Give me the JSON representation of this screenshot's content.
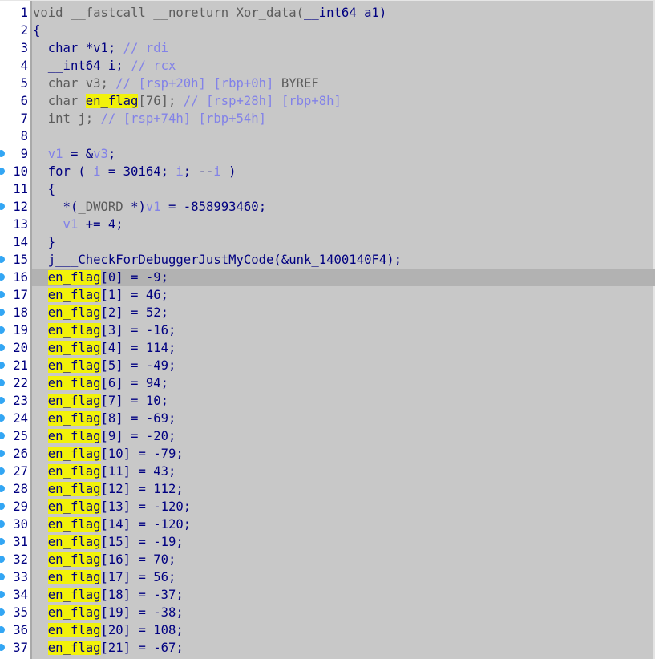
{
  "editor": {
    "function_name": "Xor_data",
    "lines": [
      {
        "no": "1",
        "bp": false,
        "tokens": [
          [
            "gr",
            "void __fastcall __noreturn Xor_data("
          ],
          [
            "k",
            "__int64 a1)"
          ]
        ]
      },
      {
        "no": "2",
        "bp": false,
        "tokens": [
          [
            "k",
            "{"
          ]
        ]
      },
      {
        "no": "3",
        "bp": false,
        "tokens": [
          [
            "k",
            "  char *v1; "
          ],
          [
            "cm",
            "// rdi"
          ]
        ]
      },
      {
        "no": "4",
        "bp": false,
        "tokens": [
          [
            "k",
            "  __int64 i; "
          ],
          [
            "cm",
            "// rcx"
          ]
        ]
      },
      {
        "no": "5",
        "bp": false,
        "tokens": [
          [
            "gr",
            "  char v3; "
          ],
          [
            "cm",
            "// [rsp+20h] [rbp+0h] "
          ],
          [
            "gr",
            "BYREF"
          ]
        ]
      },
      {
        "no": "6",
        "bp": false,
        "tokens": [
          [
            "gr",
            "  char "
          ],
          [
            "hl",
            "en_flag"
          ],
          [
            "gr",
            "[76]; "
          ],
          [
            "cm",
            "// [rsp+28h] [rbp+8h]"
          ]
        ]
      },
      {
        "no": "7",
        "bp": false,
        "tokens": [
          [
            "gr",
            "  int j; "
          ],
          [
            "cm",
            "// [rsp+74h] [rbp+54h]"
          ]
        ]
      },
      {
        "no": "8",
        "bp": false,
        "tokens": []
      },
      {
        "no": "9",
        "bp": true,
        "tokens": [
          [
            "var",
            "  v1"
          ],
          [
            "k",
            " = &"
          ],
          [
            "var",
            "v3"
          ],
          [
            "k",
            ";"
          ]
        ]
      },
      {
        "no": "10",
        "bp": true,
        "tokens": [
          [
            "k",
            "  for ( "
          ],
          [
            "var",
            "i"
          ],
          [
            "k",
            " = 30i64; "
          ],
          [
            "var",
            "i"
          ],
          [
            "k",
            "; --"
          ],
          [
            "var",
            "i"
          ],
          [
            "k",
            " )"
          ]
        ]
      },
      {
        "no": "11",
        "bp": false,
        "tokens": [
          [
            "k",
            "  {"
          ]
        ]
      },
      {
        "no": "12",
        "bp": true,
        "tokens": [
          [
            "k",
            "    *("
          ],
          [
            "gr",
            "_DWORD"
          ],
          [
            "k",
            " *)"
          ],
          [
            "var",
            "v1"
          ],
          [
            "k",
            " = -858993460;"
          ]
        ]
      },
      {
        "no": "13",
        "bp": false,
        "tokens": [
          [
            "var",
            "    v1"
          ],
          [
            "k",
            " += 4;"
          ]
        ]
      },
      {
        "no": "14",
        "bp": false,
        "tokens": [
          [
            "k",
            "  }"
          ]
        ]
      },
      {
        "no": "15",
        "bp": true,
        "tokens": [
          [
            "k",
            "  j___CheckForDebuggerJustMyCode(&unk_1400140F4);"
          ]
        ]
      },
      {
        "no": "16",
        "bp": true,
        "cur": true,
        "tokens": [
          [
            "k",
            "  "
          ],
          [
            "hl",
            "en_flag"
          ],
          [
            "k",
            "[0] = -9;"
          ]
        ]
      },
      {
        "no": "17",
        "bp": true,
        "tokens": [
          [
            "k",
            "  "
          ],
          [
            "hl",
            "en_flag"
          ],
          [
            "k",
            "[1] = 46;"
          ]
        ]
      },
      {
        "no": "18",
        "bp": true,
        "tokens": [
          [
            "k",
            "  "
          ],
          [
            "hl",
            "en_flag"
          ],
          [
            "k",
            "[2] = 52;"
          ]
        ]
      },
      {
        "no": "19",
        "bp": true,
        "tokens": [
          [
            "k",
            "  "
          ],
          [
            "hl",
            "en_flag"
          ],
          [
            "k",
            "[3] = -16;"
          ]
        ]
      },
      {
        "no": "20",
        "bp": true,
        "tokens": [
          [
            "k",
            "  "
          ],
          [
            "hl",
            "en_flag"
          ],
          [
            "k",
            "[4] = 114;"
          ]
        ]
      },
      {
        "no": "21",
        "bp": true,
        "tokens": [
          [
            "k",
            "  "
          ],
          [
            "hl",
            "en_flag"
          ],
          [
            "k",
            "[5] = -49;"
          ]
        ]
      },
      {
        "no": "22",
        "bp": true,
        "tokens": [
          [
            "k",
            "  "
          ],
          [
            "hl",
            "en_flag"
          ],
          [
            "k",
            "[6] = 94;"
          ]
        ]
      },
      {
        "no": "23",
        "bp": true,
        "tokens": [
          [
            "k",
            "  "
          ],
          [
            "hl",
            "en_flag"
          ],
          [
            "k",
            "[7] = 10;"
          ]
        ]
      },
      {
        "no": "24",
        "bp": true,
        "tokens": [
          [
            "k",
            "  "
          ],
          [
            "hl",
            "en_flag"
          ],
          [
            "k",
            "[8] = -69;"
          ]
        ]
      },
      {
        "no": "25",
        "bp": true,
        "tokens": [
          [
            "k",
            "  "
          ],
          [
            "hl",
            "en_flag"
          ],
          [
            "k",
            "[9] = -20;"
          ]
        ]
      },
      {
        "no": "26",
        "bp": true,
        "tokens": [
          [
            "k",
            "  "
          ],
          [
            "hl",
            "en_flag"
          ],
          [
            "k",
            "[10] = -79;"
          ]
        ]
      },
      {
        "no": "27",
        "bp": true,
        "tokens": [
          [
            "k",
            "  "
          ],
          [
            "hl",
            "en_flag"
          ],
          [
            "k",
            "[11] = 43;"
          ]
        ]
      },
      {
        "no": "28",
        "bp": true,
        "tokens": [
          [
            "k",
            "  "
          ],
          [
            "hl",
            "en_flag"
          ],
          [
            "k",
            "[12] = 112;"
          ]
        ]
      },
      {
        "no": "29",
        "bp": true,
        "tokens": [
          [
            "k",
            "  "
          ],
          [
            "hl",
            "en_flag"
          ],
          [
            "k",
            "[13] = -120;"
          ]
        ]
      },
      {
        "no": "30",
        "bp": true,
        "tokens": [
          [
            "k",
            "  "
          ],
          [
            "hl",
            "en_flag"
          ],
          [
            "k",
            "[14] = -120;"
          ]
        ]
      },
      {
        "no": "31",
        "bp": true,
        "tokens": [
          [
            "k",
            "  "
          ],
          [
            "hl",
            "en_flag"
          ],
          [
            "k",
            "[15] = -19;"
          ]
        ]
      },
      {
        "no": "32",
        "bp": true,
        "tokens": [
          [
            "k",
            "  "
          ],
          [
            "hl",
            "en_flag"
          ],
          [
            "k",
            "[16] = 70;"
          ]
        ]
      },
      {
        "no": "33",
        "bp": true,
        "tokens": [
          [
            "k",
            "  "
          ],
          [
            "hl",
            "en_flag"
          ],
          [
            "k",
            "[17] = 56;"
          ]
        ]
      },
      {
        "no": "34",
        "bp": true,
        "tokens": [
          [
            "k",
            "  "
          ],
          [
            "hl",
            "en_flag"
          ],
          [
            "k",
            "[18] = -37;"
          ]
        ]
      },
      {
        "no": "35",
        "bp": true,
        "tokens": [
          [
            "k",
            "  "
          ],
          [
            "hl",
            "en_flag"
          ],
          [
            "k",
            "[19] = -38;"
          ]
        ]
      },
      {
        "no": "36",
        "bp": true,
        "tokens": [
          [
            "k",
            "  "
          ],
          [
            "hl",
            "en_flag"
          ],
          [
            "k",
            "[20] = 108;"
          ]
        ]
      },
      {
        "no": "37",
        "bp": true,
        "tokens": [
          [
            "k",
            "  "
          ],
          [
            "hl",
            "en_flag"
          ],
          [
            "k",
            "[21] = -67;"
          ]
        ]
      }
    ]
  },
  "colors": {
    "background": "#c8c8c8",
    "code_text": "#000080",
    "comment_text": "#8282e8",
    "grey_text": "#5c5c5c",
    "highlight": "#f2f20a",
    "current_line": "#b2b2b2",
    "breakpoint": "#33a6f4"
  }
}
